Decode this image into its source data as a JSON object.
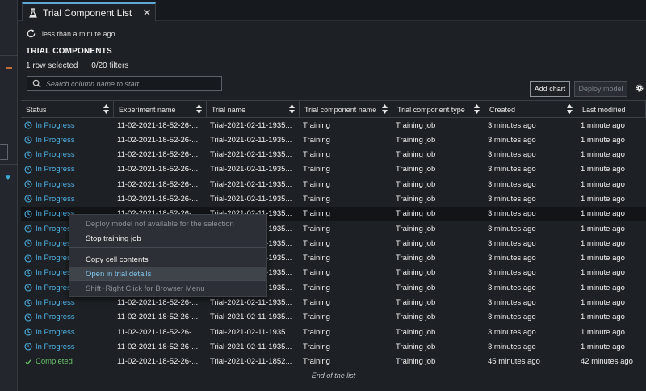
{
  "tab": {
    "title": "Trial Component List",
    "close_glyph": "✕",
    "icon": "flask-icon"
  },
  "refresh": {
    "text": "less than a minute ago",
    "icon": "refresh-icon"
  },
  "section_title": "TRIAL COMPONENTS",
  "selection": {
    "rows_selected": "1 row selected",
    "filters": "0/20 filters"
  },
  "search": {
    "placeholder": "Search column name to start"
  },
  "toolbar": {
    "add_chart": "Add chart",
    "deploy_model": "Deploy model"
  },
  "columns": [
    "Status",
    "Experiment name",
    "Trial name",
    "Trial component name",
    "Trial component type",
    "Created",
    "Last modified"
  ],
  "rows": [
    {
      "status": "In Progress",
      "experiment": "11-02-2021-18-52-26-...",
      "trial": "Trial-2021-02-11-1935...",
      "component": "Training",
      "type": "Training job",
      "created": "3 minutes ago",
      "modified": "1 minute ago"
    },
    {
      "status": "In Progress",
      "experiment": "11-02-2021-18-52-26-...",
      "trial": "Trial-2021-02-11-1935...",
      "component": "Training",
      "type": "Training job",
      "created": "3 minutes ago",
      "modified": "1 minute ago"
    },
    {
      "status": "In Progress",
      "experiment": "11-02-2021-18-52-26-...",
      "trial": "Trial-2021-02-11-1935...",
      "component": "Training",
      "type": "Training job",
      "created": "3 minutes ago",
      "modified": "1 minute ago"
    },
    {
      "status": "In Progress",
      "experiment": "11-02-2021-18-52-26-...",
      "trial": "Trial-2021-02-11-1935...",
      "component": "Training",
      "type": "Training job",
      "created": "3 minutes ago",
      "modified": "1 minute ago"
    },
    {
      "status": "In Progress",
      "experiment": "11-02-2021-18-52-26-...",
      "trial": "Trial-2021-02-11-1935...",
      "component": "Training",
      "type": "Training job",
      "created": "3 minutes ago",
      "modified": "1 minute ago"
    },
    {
      "status": "In Progress",
      "experiment": "11-02-2021-18-52-26-...",
      "trial": "Trial-2021-02-11-1935...",
      "component": "Training",
      "type": "Training job",
      "created": "3 minutes ago",
      "modified": "1 minute ago"
    },
    {
      "status": "In Progress",
      "experiment": "11-02-2021-18-52-26-...",
      "trial": "Trial-2021-02-11-1935...",
      "component": "Training",
      "type": "Training job",
      "created": "3 minutes ago",
      "modified": "1 minute ago"
    },
    {
      "status": "In Progress",
      "experiment": "11-02-2021-18-52-26-...",
      "trial": "Trial-2021-02-11-1935...",
      "component": "Training",
      "type": "Training job",
      "created": "3 minutes ago",
      "modified": "1 minute ago"
    },
    {
      "status": "In Progress",
      "experiment": "11-02-2021-18-52-26-...",
      "trial": "Trial-2021-02-11-1935...",
      "component": "Training",
      "type": "Training job",
      "created": "3 minutes ago",
      "modified": "1 minute ago"
    },
    {
      "status": "In Progress",
      "experiment": "11-02-2021-18-52-26-...",
      "trial": "Trial-2021-02-11-1935...",
      "component": "Training",
      "type": "Training job",
      "created": "3 minutes ago",
      "modified": "1 minute ago"
    },
    {
      "status": "In Progress",
      "experiment": "11-02-2021-18-52-26-...",
      "trial": "Trial-2021-02-11-1935...",
      "component": "Training",
      "type": "Training job",
      "created": "3 minutes ago",
      "modified": "1 minute ago"
    },
    {
      "status": "In Progress",
      "experiment": "11-02-2021-18-52-26-...",
      "trial": "Trial-2021-02-11-1935...",
      "component": "Training",
      "type": "Training job",
      "created": "3 minutes ago",
      "modified": "1 minute ago"
    },
    {
      "status": "In Progress",
      "experiment": "11-02-2021-18-52-26-...",
      "trial": "Trial-2021-02-11-1935...",
      "component": "Training",
      "type": "Training job",
      "created": "3 minutes ago",
      "modified": "1 minute ago"
    },
    {
      "status": "In Progress",
      "experiment": "11-02-2021-18-52-26-...",
      "trial": "Trial-2021-02-11-1935...",
      "component": "Training",
      "type": "Training job",
      "created": "3 minutes ago",
      "modified": "1 minute ago"
    },
    {
      "status": "In Progress",
      "experiment": "11-02-2021-18-52-26-...",
      "trial": "Trial-2021-02-11-1935...",
      "component": "Training",
      "type": "Training job",
      "created": "3 minutes ago",
      "modified": "1 minute ago"
    },
    {
      "status": "In Progress",
      "experiment": "11-02-2021-18-52-26-...",
      "trial": "Trial-2021-02-11-1935...",
      "component": "Training",
      "type": "Training job",
      "created": "3 minutes ago",
      "modified": "1 minute ago"
    },
    {
      "status": "Completed",
      "experiment": "11-02-2021-18-52-26-...",
      "trial": "Trial-2021-02-11-1852...",
      "component": "Training",
      "type": "Training job",
      "created": "45 minutes ago",
      "modified": "42 minutes ago"
    }
  ],
  "end_of_list": "End of the list",
  "context_menu": {
    "items": [
      {
        "label": "Deploy model not available for the selection",
        "disabled": true
      },
      {
        "label": "Stop training job",
        "disabled": false
      },
      {
        "label": "Copy cell contents",
        "disabled": false
      },
      {
        "label": "Open in trial details",
        "disabled": false
      },
      {
        "label": "Shift+Right Click for Browser Menu",
        "disabled": true
      }
    ]
  },
  "colors": {
    "accent": "#4fb3e6",
    "completed": "#6ac46a",
    "background": "#1d2024"
  }
}
